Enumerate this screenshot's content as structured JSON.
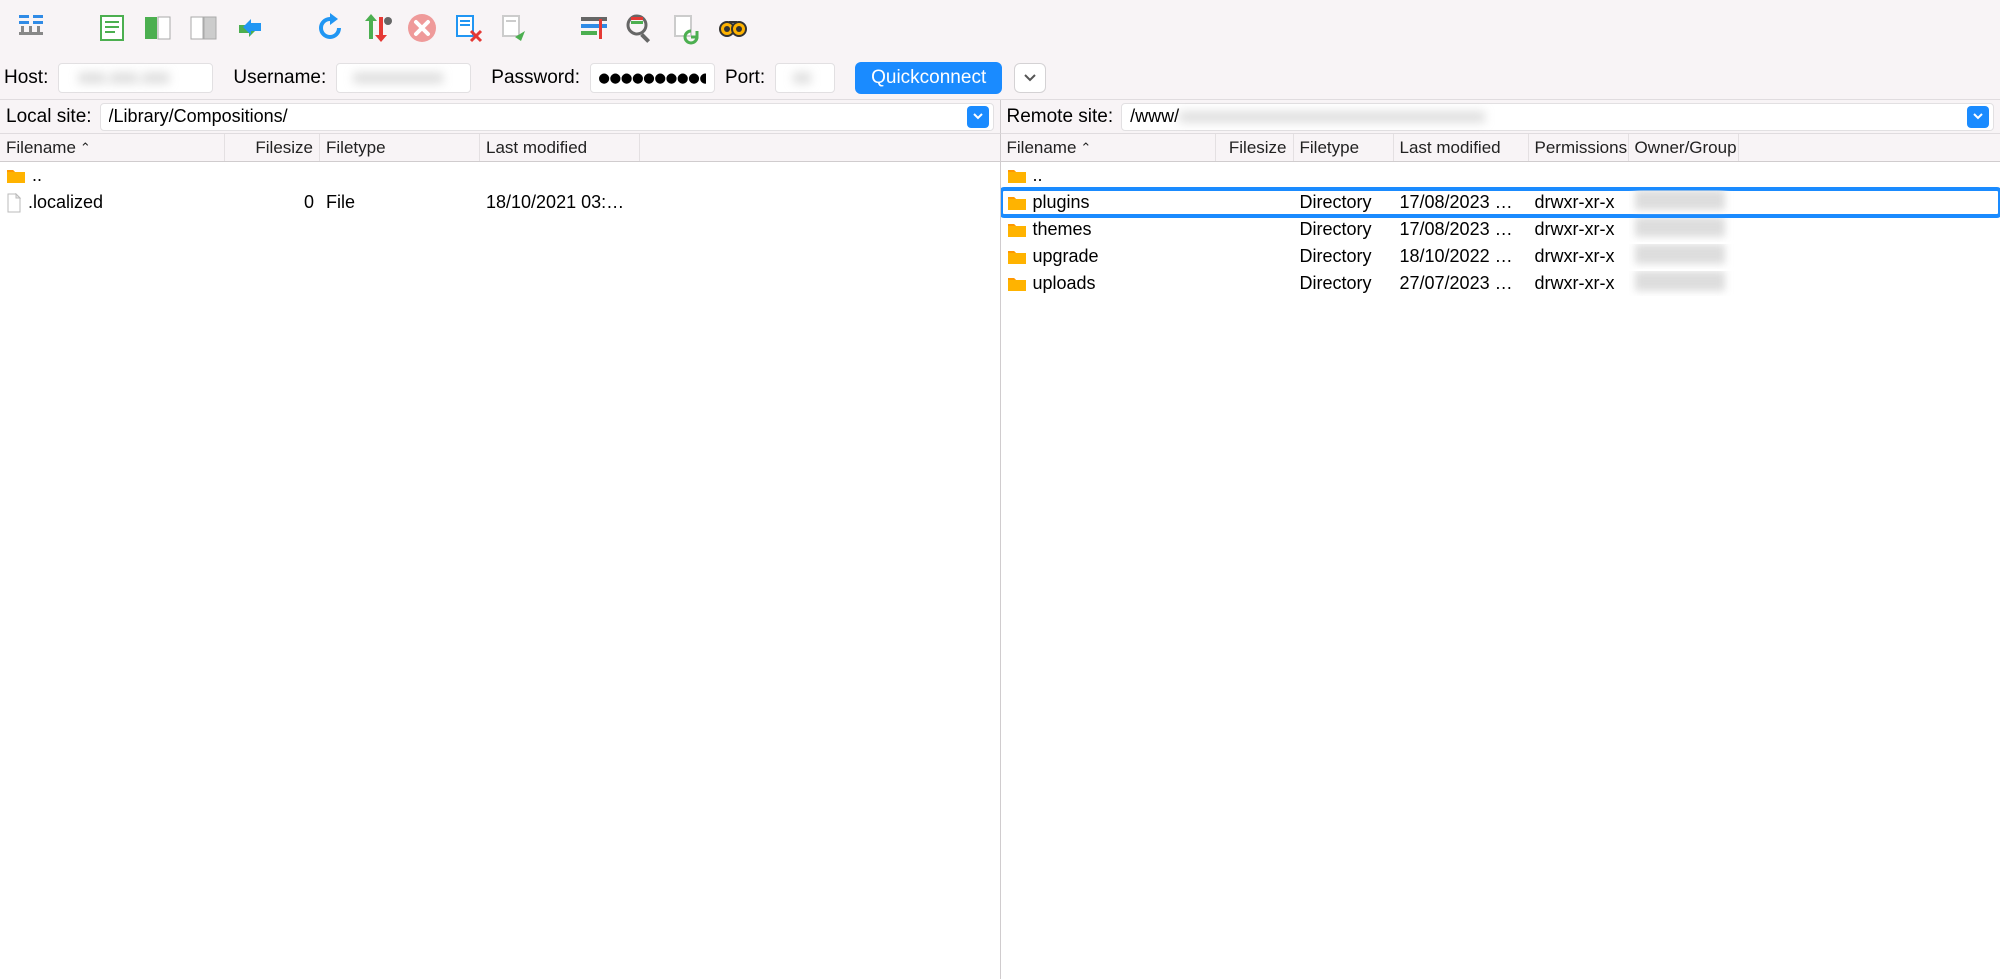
{
  "quickconnect": {
    "host_label": "Host:",
    "host_value": "",
    "user_label": "Username:",
    "user_value": "",
    "pass_label": "Password:",
    "pass_value": "●●●●●●●●●●●●",
    "port_label": "Port:",
    "port_value": "",
    "button": "Quickconnect"
  },
  "local": {
    "label": "Local site:",
    "path": "/Library/Compositions/",
    "columns": {
      "name": "Filename",
      "size": "Filesize",
      "type": "Filetype",
      "mod": "Last modified"
    },
    "rows": [
      {
        "icon": "folder",
        "name": "..",
        "size": "",
        "type": "",
        "mod": ""
      },
      {
        "icon": "file",
        "name": ".localized",
        "size": "0",
        "type": "File",
        "mod": "18/10/2021 03:3…"
      }
    ]
  },
  "remote": {
    "label": "Remote site:",
    "path_prefix": "/www/",
    "columns": {
      "name": "Filename",
      "size": "Filesize",
      "type": "Filetype",
      "mod": "Last modified",
      "perm": "Permissions",
      "owner": "Owner/Group"
    },
    "rows": [
      {
        "icon": "folder",
        "name": "..",
        "size": "",
        "type": "",
        "mod": "",
        "perm": "",
        "owner_hidden": false,
        "highlighted": false
      },
      {
        "icon": "folder",
        "name": "plugins",
        "size": "",
        "type": "Directory",
        "mod": "17/08/2023 0…",
        "perm": "drwxr-xr-x",
        "owner_hidden": true,
        "highlighted": true
      },
      {
        "icon": "folder",
        "name": "themes",
        "size": "",
        "type": "Directory",
        "mod": "17/08/2023 0…",
        "perm": "drwxr-xr-x",
        "owner_hidden": true,
        "highlighted": false
      },
      {
        "icon": "folder",
        "name": "upgrade",
        "size": "",
        "type": "Directory",
        "mod": "18/10/2022 0…",
        "perm": "drwxr-xr-x",
        "owner_hidden": true,
        "highlighted": false
      },
      {
        "icon": "folder",
        "name": "uploads",
        "size": "",
        "type": "Directory",
        "mod": "27/07/2023 1…",
        "perm": "drwxr-xr-x",
        "owner_hidden": true,
        "highlighted": false
      }
    ]
  }
}
